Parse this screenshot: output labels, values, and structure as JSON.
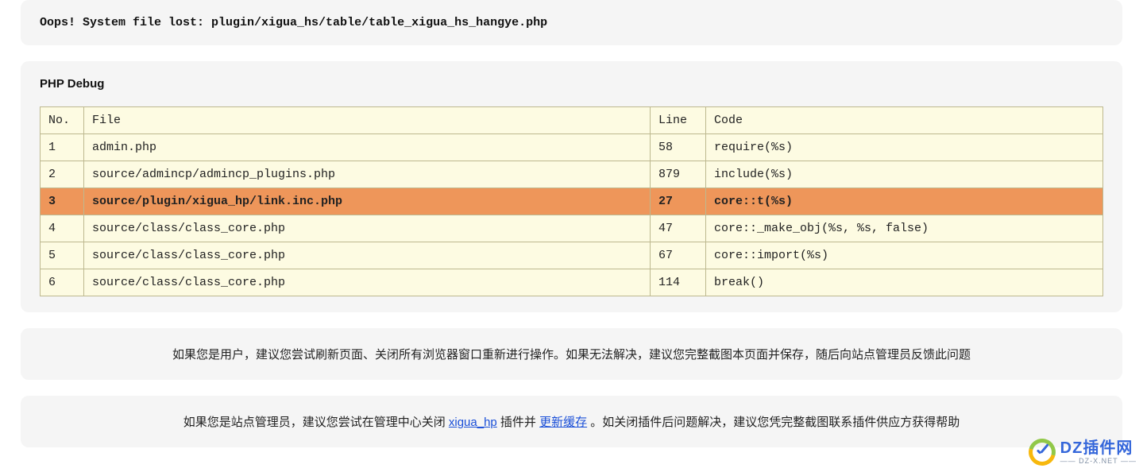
{
  "error": {
    "message": "Oops! System file lost: plugin/xigua_hs/table/table_xigua_hs_hangye.php"
  },
  "debug": {
    "title": "PHP Debug",
    "columns": {
      "no": "No.",
      "file": "File",
      "line": "Line",
      "code": "Code"
    },
    "rows": [
      {
        "no": "1",
        "file": "admin.php",
        "line": "58",
        "code": "require(%s)",
        "highlight": false
      },
      {
        "no": "2",
        "file": "source/admincp/admincp_plugins.php",
        "line": "879",
        "code": "include(%s)",
        "highlight": false
      },
      {
        "no": "3",
        "file": "source/plugin/xigua_hp/link.inc.php",
        "line": "27",
        "code": "core::t(%s)",
        "highlight": true
      },
      {
        "no": "4",
        "file": "source/class/class_core.php",
        "line": "47",
        "code": "core::_make_obj(%s, %s, false)",
        "highlight": false
      },
      {
        "no": "5",
        "file": "source/class/class_core.php",
        "line": "67",
        "code": "core::import(%s)",
        "highlight": false
      },
      {
        "no": "6",
        "file": "source/class/class_core.php",
        "line": "114",
        "code": "break()",
        "highlight": false
      }
    ]
  },
  "advice_user": {
    "text": "如果您是用户，建议您尝试刷新页面、关闭所有浏览器窗口重新进行操作。如果无法解决，建议您完整截图本页面并保存，随后向站点管理员反馈此问题"
  },
  "advice_admin": {
    "prefix": "如果您是站点管理员，建议您尝试在管理中心关闭 ",
    "link1_text": "xigua_hp",
    "mid": " 插件并 ",
    "link2_text": "更新缓存",
    "suffix": " 。如关闭插件后问题解决，建议您凭完整截图联系插件供应方获得帮助"
  },
  "watermark": {
    "text": "DZ插件网",
    "sub": "—— DZ-X.NET ——"
  }
}
